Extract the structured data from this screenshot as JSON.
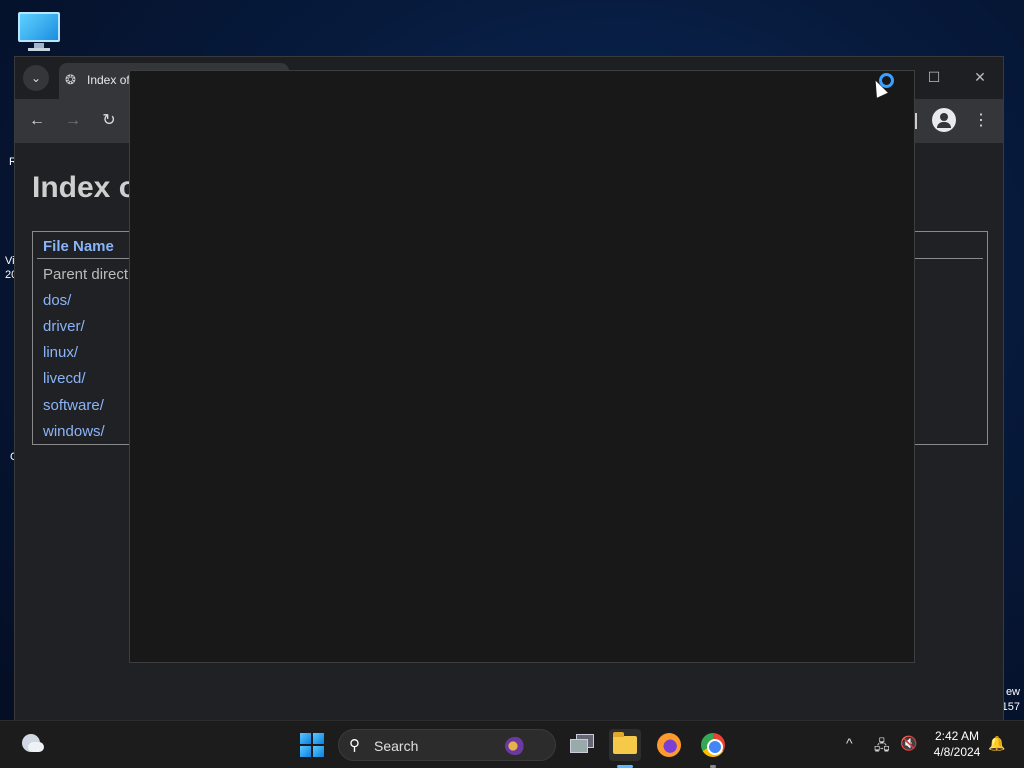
{
  "desktop": {
    "icon_name": "this-pc-icon",
    "left_fragments": [
      "R",
      "Vi",
      "20",
      "C"
    ],
    "right_fragments": [
      "ew",
      "157"
    ]
  },
  "browser": {
    "tab": {
      "title": "Index of",
      "menu_icon": "chevron-down-icon"
    },
    "window_controls": {
      "minimize": "—",
      "maximize": "☐",
      "close": "✕"
    },
    "toolbar": {
      "back": "←",
      "forward": "→",
      "reload": "↻",
      "menu": "⋮"
    },
    "page": {
      "heading": "Index o",
      "column_header": "File Name",
      "rows": [
        "Parent direct",
        "dos/",
        "driver/",
        "linux/",
        "livecd/",
        "software/",
        "windows/"
      ]
    }
  },
  "overlay": {
    "state": "loading"
  },
  "taskbar": {
    "search_placeholder": "Search",
    "search_icon": "⚲",
    "tray": {
      "chevron": "^",
      "network": "🖧",
      "volume": "🔇",
      "notification": "🔔"
    },
    "clock": {
      "time": "2:42 AM",
      "date": "4/8/2024"
    }
  }
}
